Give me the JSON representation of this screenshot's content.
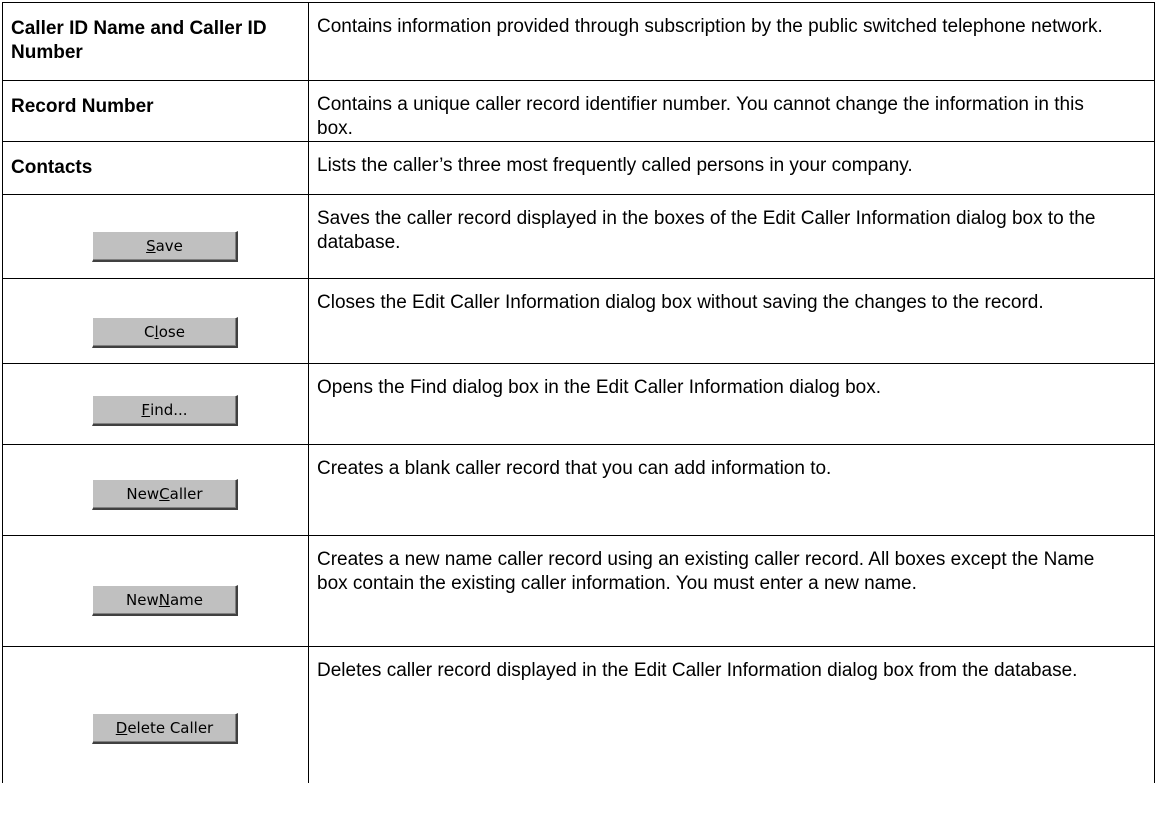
{
  "rows": [
    {
      "term": "Caller ID Name and Caller ID Number",
      "description": "Contains information provided through subscription by the public switched telephone network."
    },
    {
      "term": "Record Number",
      "description": "Contains a unique caller record identifier number. You cannot change the information in this box."
    },
    {
      "term": "Contacts",
      "description": "Lists the caller’s three most frequently called persons in your company."
    },
    {
      "button": {
        "before": "",
        "mnemonic": "S",
        "after": "ave"
      },
      "description": "Saves the caller record displayed in the boxes of the Edit Caller Information dialog box to the database."
    },
    {
      "button": {
        "before": "C",
        "mnemonic": "l",
        "after": "ose"
      },
      "description": "Closes the Edit Caller Information dialog box without saving the changes to the record."
    },
    {
      "button": {
        "before": "",
        "mnemonic": "F",
        "after": "ind..."
      },
      "description": "Opens the Find dialog box in the Edit Caller Information dialog box."
    },
    {
      "button": {
        "before": "New ",
        "mnemonic": "C",
        "after": "aller"
      },
      "description": "Creates a blank caller record that you can add information to."
    },
    {
      "button": {
        "before": "New ",
        "mnemonic": "N",
        "after": "ame"
      },
      "description": "Creates a new name caller record using an existing caller record. All boxes except the Name box contain the existing caller information. You must enter a new name."
    },
    {
      "button": {
        "before": "",
        "mnemonic": "D",
        "after": "elete Caller"
      },
      "description": "Deletes caller record displayed in the Edit Caller Information dialog box from the database."
    }
  ]
}
